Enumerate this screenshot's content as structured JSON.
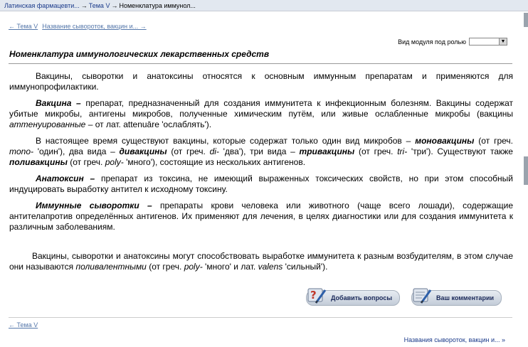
{
  "breadcrumb": {
    "items": [
      "Латинская фармацевти...",
      "Тема V",
      "Номенклатура иммунол..."
    ],
    "separator": "→"
  },
  "nav": {
    "prev_top": "← Тема V",
    "next_top": "Название сывороток, вакцин и... →",
    "prev_bottom": "← Тема V",
    "next_bottom": "Названия сывороток, вакцин и... »"
  },
  "role_select": {
    "label": "Вид модуля под ролью",
    "value": ""
  },
  "page_title": "Номенклатура иммунологических лекарственных средств",
  "paragraphs": {
    "p1": "Вакцины, сыворотки и анатоксины относятся к основным иммунным препаратам и применяются для иммунопрофилактики.",
    "p2_term": "Вакцина –",
    "p2_a": " препарат, предназначенный для создания иммунитета к инфекционным болезням. Вакцины содержат убитые микробы, антигены микробов, полученные химическим путём, или живые ослабленные микробы (вакцины ",
    "p2_term2": "аттенуированные",
    "p2_b": " – от лат. attenuāre 'ослаблять').",
    "p3_a": "В настоящее время существуют вакцины, которые содержат только один вид микробов – ",
    "p3_t1": "моновакцины",
    "p3_b": " (от греч. ",
    "p3_i1": "mono-",
    "p3_c": " 'один'), два вида – ",
    "p3_t2": "дивакцины",
    "p3_d": " (от греч. ",
    "p3_i2": "di-",
    "p3_e": " 'два'), три вида – ",
    "p3_t3": "тривакцины",
    "p3_f": " (от греч. ",
    "p3_i3": "tri-",
    "p3_g": " 'три'). Существуют также ",
    "p3_t4": "поливакцины",
    "p3_h": " (от греч. ",
    "p3_i4": "poly-",
    "p3_j": " 'много'), состоящие из нескольких антигенов.",
    "p4_term": "Анатоксин –",
    "p4_a": " препарат из токсина, не имеющий выраженных токсических свойств, но при этом способный индуцировать выработку антител к исходному токсину.",
    "p5_term": "Иммунные сыворотки –",
    "p5_a": " препараты крови человека или животного (чаще всего лошади), содержащие антителапротив определённых антигенов. Их применяют для лечения, в целях диагностики или для создания иммунитета к различным заболеваниям.",
    "p6_a": "Вакцины, сыворотки и анатоксины могут способствовать выработке иммунитета к разным возбудителям, в этом случае они называются ",
    "p6_term": "поливалентными",
    "p6_b": " (от греч. ",
    "p6_i1": "poly-",
    "p6_c": " 'много' и лат. ",
    "p6_i2": "valens",
    "p6_d": " 'сильный')."
  },
  "buttons": {
    "add_questions": "Добавить вопросы",
    "your_comments": "Ваш комментарии"
  },
  "icons": {
    "add_questions": "question-pen-icon",
    "your_comments": "comment-pen-icon"
  }
}
